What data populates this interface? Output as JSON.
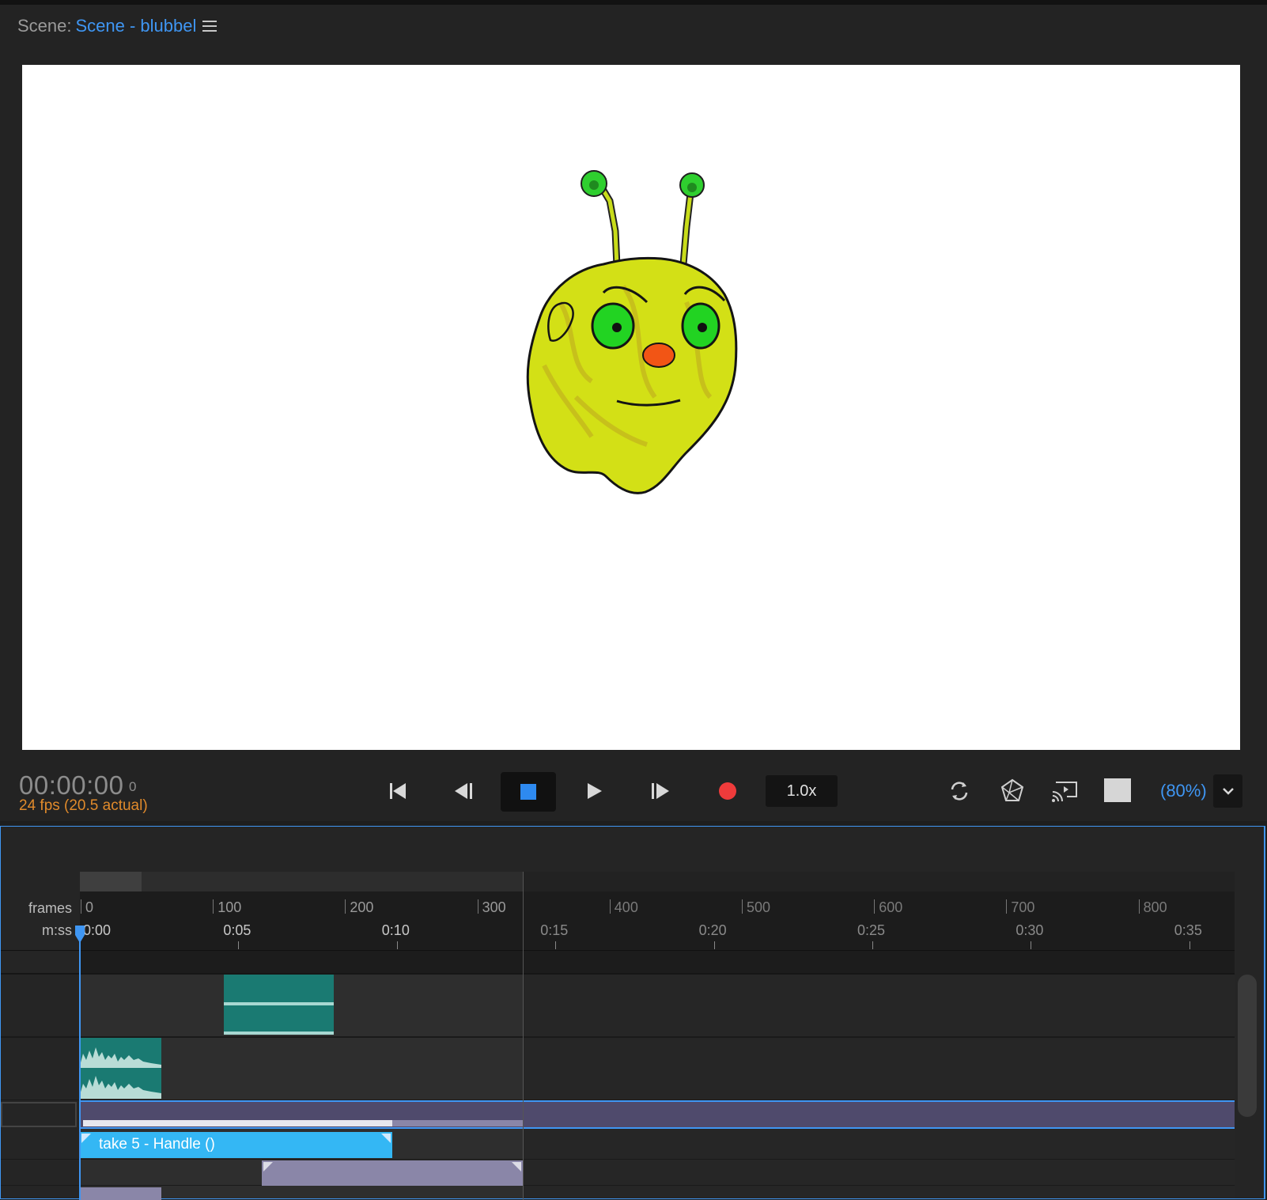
{
  "scene": {
    "label": "Scene:",
    "name": "Scene - blubbel"
  },
  "icons": {
    "menu": "hamburger-menu-icon",
    "skip_start": "skip-to-start-icon",
    "step_back": "step-back-icon",
    "stop": "stop-icon",
    "play": "play-icon",
    "step_forward": "step-forward-icon",
    "record": "record-icon",
    "loop": "loop-icon",
    "puppet": "puppet-mesh-icon",
    "cast": "cast-icon",
    "background": "background-swatch-icon",
    "dropdown": "chevron-down-icon"
  },
  "transport": {
    "timecode": "00:00:00",
    "frame": "0",
    "fps": "24 fps (20.5 actual)",
    "speed": "1.0x",
    "zoom": "(80%)"
  },
  "colors": {
    "accent": "#3f96f3",
    "fps": "#e08a2b",
    "record": "#ef3b3b",
    "audio_clip": "#1a7a72",
    "take_clip": "#34b7f4",
    "trigger_clip": "#8a86a8"
  },
  "timeline": {
    "frames_label": "frames",
    "mss_label": "m:ss",
    "frame_ticks": [
      "0",
      "100",
      "200",
      "300",
      "400",
      "500",
      "600",
      "700",
      "800"
    ],
    "time_ticks": [
      "0:00",
      "0:05",
      "0:10",
      "0:15",
      "0:20",
      "0:25",
      "0:30",
      "0:35"
    ],
    "take_clip_label": "take 5 - Handle ()"
  }
}
